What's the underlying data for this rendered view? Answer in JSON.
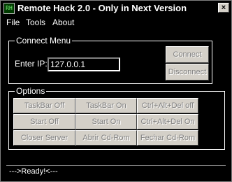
{
  "window": {
    "title": "Remote Hack 2.0 - Only in Next Version",
    "app_icon_glyph": "RH",
    "close_glyph": "×"
  },
  "menu": {
    "items": [
      "File",
      "Tools",
      "About"
    ]
  },
  "connect_menu": {
    "title": "Connect Menu",
    "ip_label": "Enter IP:",
    "ip_value": "127.0.0.1",
    "connect_label": "Connect",
    "disconnect_label": "Disconnect"
  },
  "options": {
    "title": "Options",
    "buttons": [
      [
        "TaskBar Off",
        "TaskBar On",
        "Ctrl+Alt+Del off"
      ],
      [
        "Start Off",
        "Start On",
        "Ctrl+Alt+Del On"
      ],
      [
        "Closer Server",
        "Abrir Cd-Rom",
        "Fechar Cd-Rom"
      ]
    ]
  },
  "status": {
    "text": "--->Ready!<---"
  },
  "colors": {
    "background": "#000000",
    "button_face": "#d4d0c8",
    "disabled_text": "#808080",
    "text": "#ffffff"
  }
}
